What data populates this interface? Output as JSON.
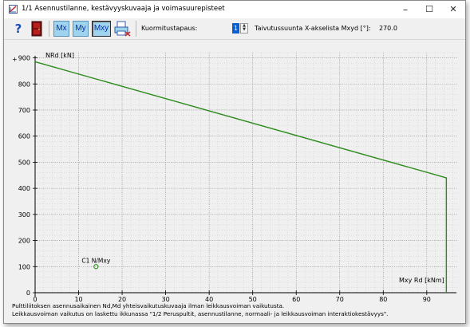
{
  "window": {
    "title": "1/1  Asennustilanne, kestävyyskuvaaja ja voimasuurepisteet",
    "minimize": "–",
    "maximize": "☐",
    "close": "✕"
  },
  "toolbar": {
    "help_label": "?",
    "exit_icon": "door-icon",
    "mx_label": "Mx",
    "my_label": "My",
    "mxy_label": "Mxy",
    "print_icon": "printer-icon",
    "load_case_label": "Kuormitustapaus:",
    "load_case_value": "1",
    "bending_direction_label": "Taivutussuunta X-akselista Mxyd [°]:",
    "bending_direction_value": "270.0"
  },
  "chart_data": {
    "type": "line",
    "ylabel": "NRd [kN]",
    "xlabel": "Mxy Rd [kNm]",
    "xlim": [
      0,
      97
    ],
    "ylim": [
      0,
      920
    ],
    "x_ticks": [
      "0",
      "10",
      "20",
      "30",
      "40",
      "50",
      "60",
      "70",
      "80",
      "90"
    ],
    "y_ticks": [
      "0",
      "100",
      "200",
      "300",
      "400",
      "500",
      "600",
      "700",
      "800",
      "900"
    ],
    "grid": true,
    "series": [
      {
        "color": "#2e8b1e",
        "x": [
          0,
          93.5,
          94.5,
          94.5
        ],
        "y": [
          885,
          445,
          440,
          0
        ]
      }
    ],
    "points": [
      {
        "label": "C1 N/Mxy",
        "x": 14,
        "y": 100,
        "color": "#2e8b1e"
      }
    ]
  },
  "notes": {
    "line1": "Pulttiliitoksen asennusaikainen Nd,Md yhteisvaikutuskuvaaja ilman leikkausvoiman vaikutusta.",
    "line2": "Leikkausvoiman vaikutus on laskettu ikkunassa \"1/2 Peruspultit, asennustilanne, normaali- ja leikkausvoiman  interaktiokestävyys\"."
  }
}
